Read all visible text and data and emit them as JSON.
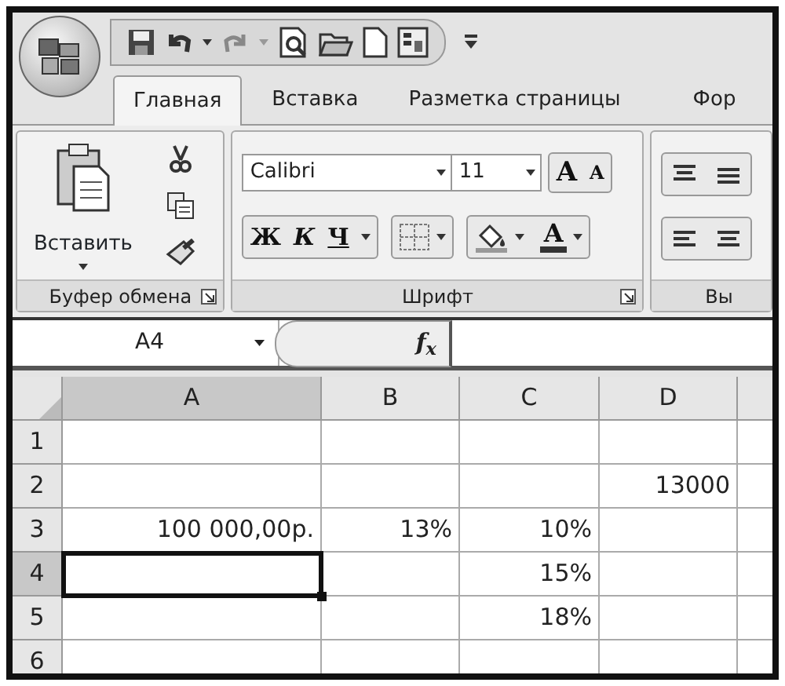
{
  "ribbon_tabs": [
    {
      "label": "Главная",
      "selected": true
    },
    {
      "label": "Вставка",
      "selected": false
    },
    {
      "label": "Разметка страницы",
      "selected": false
    },
    {
      "label": "Фор",
      "selected": false
    }
  ],
  "clipboard_group": {
    "title": "Буфер обмена",
    "paste_label": "Вставить"
  },
  "font_group": {
    "title": "Шрифт",
    "font_name": "Calibri",
    "font_size": "11",
    "grow_font": "A",
    "shrink_font": "A",
    "bold": "Ж",
    "italic": "К",
    "underline": "Ч",
    "font_color": "A"
  },
  "alignment_group": {
    "title": "Вы"
  },
  "formula_bar": {
    "name_box": "A4",
    "function_label": "f$_{x}$"
  },
  "sheet": {
    "columns": [
      "A",
      "B",
      "C",
      "D"
    ],
    "rows": [
      {
        "header": "1",
        "cells": [
          {
            "selected": false
          },
          {
            "selected": false
          },
          {
            "selected": false
          },
          {
            "selected": false
          }
        ]
      },
      {
        "header": "2",
        "cells": [
          {
            "selected": false
          },
          {
            "selected": false
          },
          {
            "selected": false
          },
          {
            "text": "13000",
            "selected": false
          }
        ]
      },
      {
        "header": "3",
        "cells": [
          {
            "text": "100 000,00р.",
            "selected": false
          },
          {
            "text": "13%",
            "selected": false
          },
          {
            "text": "10%",
            "selected": false
          },
          {
            "selected": false
          }
        ]
      },
      {
        "header": "4",
        "cells": [
          {
            "selected": true
          },
          {
            "selected": false
          },
          {
            "text": "15%",
            "selected": false
          },
          {
            "selected": false
          }
        ]
      },
      {
        "header": "5",
        "cells": [
          {
            "selected": false
          },
          {
            "selected": false
          },
          {
            "text": "18%",
            "selected": false
          },
          {
            "selected": false
          }
        ]
      },
      {
        "header": "6",
        "cells": [
          {
            "selected": false
          },
          {
            "selected": false
          },
          {
            "selected": false
          },
          {
            "selected": false
          }
        ]
      }
    ]
  }
}
